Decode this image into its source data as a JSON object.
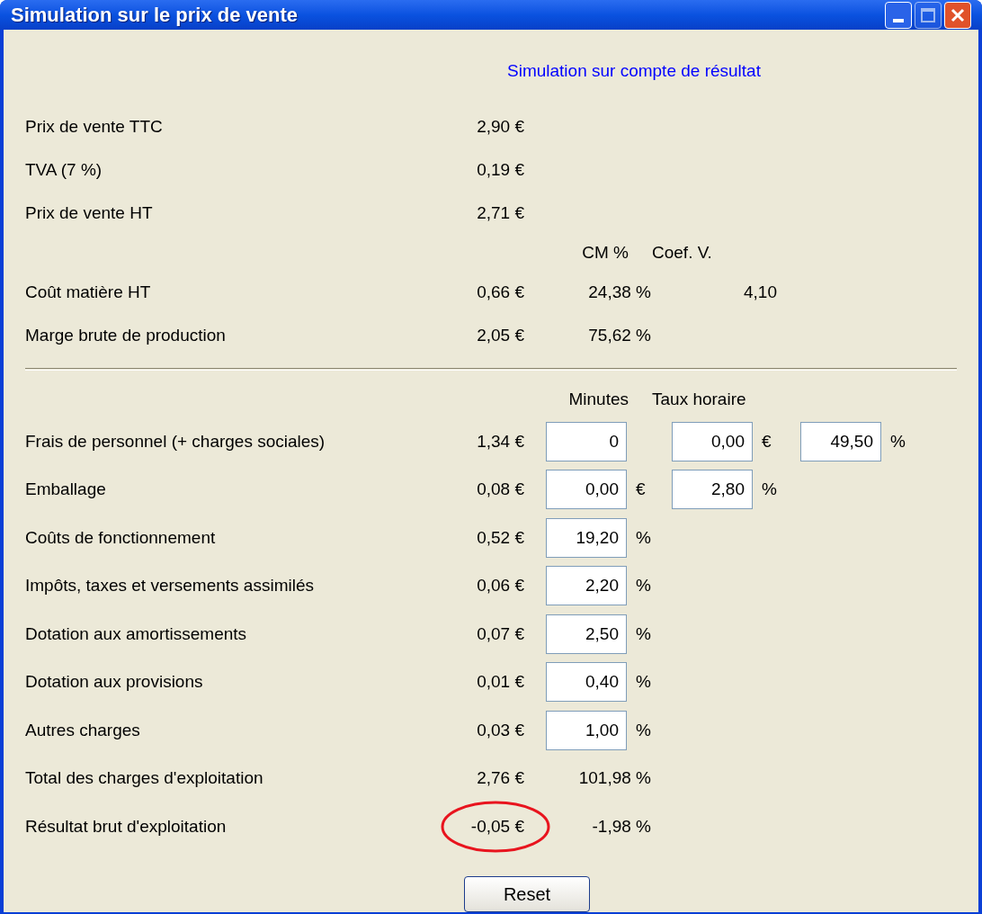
{
  "window": {
    "title": "Simulation sur le prix de vente"
  },
  "heading": "Simulation sur compte de résultat",
  "sections": [
    {
      "rows": [
        {
          "kind": "row",
          "label": "Prix de vente TTC",
          "amount": "2,90 €",
          "cells": []
        },
        {
          "kind": "row",
          "label": "TVA (7 %)",
          "amount": "0,19 €",
          "cells": []
        },
        {
          "kind": "row",
          "label": "Prix de vente HT",
          "amount": "2,71 €",
          "cells": []
        },
        {
          "kind": "header",
          "cells": [
            {
              "kind": "text",
              "value": "CM %"
            },
            {
              "kind": "text",
              "value": "Coef. V."
            }
          ]
        },
        {
          "kind": "row",
          "label": "Coût matière HT",
          "amount": "0,66 €",
          "cells": [
            {
              "kind": "text",
              "value": "24,38 %"
            },
            {
              "kind": "text",
              "value": "4,10"
            }
          ]
        },
        {
          "kind": "row",
          "label": "Marge brute de production",
          "amount": "2,05 €",
          "cells": [
            {
              "kind": "text",
              "value": "75,62 %"
            }
          ]
        }
      ]
    },
    {
      "rows": [
        {
          "kind": "header",
          "cells": [
            {
              "kind": "text",
              "value": "Minutes"
            },
            {
              "kind": "text",
              "value": "Taux horaire"
            }
          ]
        },
        {
          "kind": "row",
          "label": "Frais de personnel (+ charges sociales)",
          "amount": "1,34 €",
          "cells": [
            {
              "kind": "field",
              "value": "0"
            },
            {
              "kind": "field",
              "value": "0,00",
              "unit": "€"
            },
            {
              "kind": "field",
              "value": "49,50",
              "unit": "%"
            }
          ]
        },
        {
          "kind": "row",
          "label": "Emballage",
          "amount": "0,08 €",
          "cells": [
            {
              "kind": "field",
              "value": "0,00",
              "unit": "€"
            },
            {
              "kind": "field",
              "value": "2,80",
              "unit": "%"
            }
          ]
        },
        {
          "kind": "row",
          "label": "Coûts de fonctionnement",
          "amount": "0,52 €",
          "cells": [
            {
              "kind": "field",
              "value": "19,20",
              "unit": "%"
            }
          ]
        },
        {
          "kind": "row",
          "label": "Impôts, taxes et versements assimilés",
          "amount": "0,06 €",
          "cells": [
            {
              "kind": "field",
              "value": "2,20",
              "unit": "%"
            }
          ]
        },
        {
          "kind": "row",
          "label": "Dotation aux amortissements",
          "amount": "0,07 €",
          "cells": [
            {
              "kind": "field",
              "value": "2,50",
              "unit": "%"
            }
          ]
        },
        {
          "kind": "row",
          "label": "Dotation aux provisions",
          "amount": "0,01 €",
          "cells": [
            {
              "kind": "field",
              "value": "0,40",
              "unit": "%"
            }
          ]
        },
        {
          "kind": "row",
          "label": "Autres charges",
          "amount": "0,03 €",
          "cells": [
            {
              "kind": "field",
              "value": "1,00",
              "unit": "%"
            }
          ]
        },
        {
          "kind": "row",
          "label": "Total des charges d'exploitation",
          "amount": "2,76 €",
          "cells": [
            {
              "kind": "text",
              "value": "101,98 %"
            }
          ]
        },
        {
          "kind": "row",
          "label": "Résultat brut d'exploitation",
          "amount": "-0,05 €",
          "circled": true,
          "cells": [
            {
              "kind": "text",
              "value": "-1,98 %"
            }
          ]
        }
      ]
    }
  ],
  "button": "Reset"
}
